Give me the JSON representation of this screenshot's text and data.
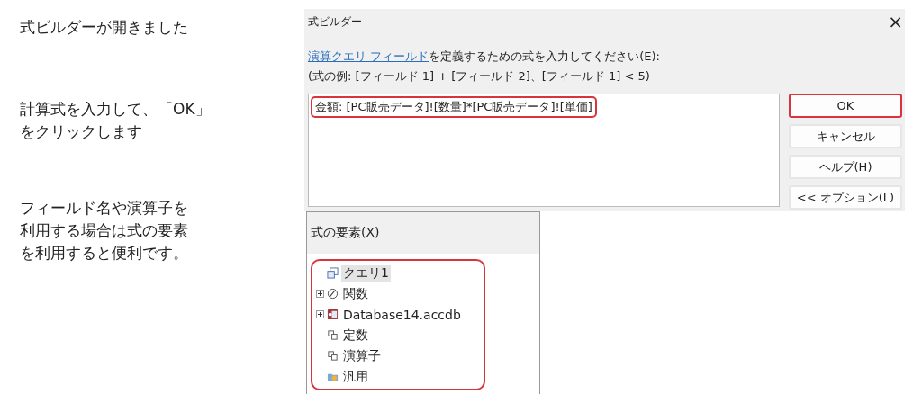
{
  "notes": [
    {
      "lines": [
        "式ビルダーが開きました"
      ]
    },
    {
      "lines": [
        "計算式を入力して、「OK」",
        "をクリックします"
      ]
    },
    {
      "lines": [
        "フィールド名や演算子を",
        "利用する場合は式の要素",
        "を利用すると便利です。"
      ]
    }
  ],
  "dialog": {
    "title": "式ビルダー",
    "close": "×",
    "instruction": {
      "link": "演算クエリ フィールド",
      "text": "を定義するための式を入力してください(E):"
    },
    "example": "(式の例: [フィールド 1] + [フィールド 2]、[フィールド 1] < 5)",
    "expression": {
      "value": "金額: [PC販売データ]![数量]*[PC販売データ]![単価]",
      "highlighted": true
    },
    "buttons": [
      {
        "label": "OK",
        "highlighted": true
      },
      {
        "label": "キャンセル",
        "highlighted": false
      },
      {
        "label": "ヘルプ(H)",
        "highlighted": false
      },
      {
        "label": "<< オプション(L)",
        "highlighted": false
      }
    ],
    "elements": {
      "title": "式の要素(X)",
      "highlighted": true,
      "items": [
        {
          "label": "クエリ1",
          "kind": "query",
          "selected": true
        },
        {
          "label": "関数",
          "kind": "function",
          "selected": false
        },
        {
          "label": "Database14.accdb",
          "kind": "database",
          "selected": false
        },
        {
          "label": "定数",
          "kind": "constant",
          "selected": false
        },
        {
          "label": "演算子",
          "kind": "operator",
          "selected": false
        },
        {
          "label": "汎用",
          "kind": "common",
          "selected": false
        }
      ]
    }
  }
}
